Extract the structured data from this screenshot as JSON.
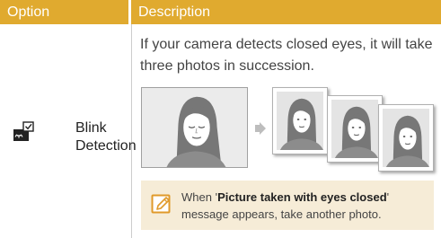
{
  "table": {
    "headers": {
      "option": "Option",
      "description": "Description"
    },
    "row": {
      "option_icon": "blink-detection-icon",
      "option_label_line1": "Blink",
      "option_label_line2": "Detection",
      "description": "If your camera detects closed eyes, it will take three photos in succession."
    }
  },
  "illustration": {
    "main_image": "portrait-eyes-closed",
    "arrow_icon": "right-arrow-icon",
    "burst_images": [
      "portrait-1",
      "portrait-2",
      "portrait-3"
    ]
  },
  "note": {
    "icon": "note-pencil-icon",
    "prefix": "When '",
    "bold": "Picture taken with eyes closed",
    "suffix": "' message appears, take another photo."
  },
  "colors": {
    "header_bg": "#e0aa2f",
    "header_text": "#ffffff",
    "note_bg": "#f6ecd7",
    "accent_orange": "#e09a2a"
  }
}
